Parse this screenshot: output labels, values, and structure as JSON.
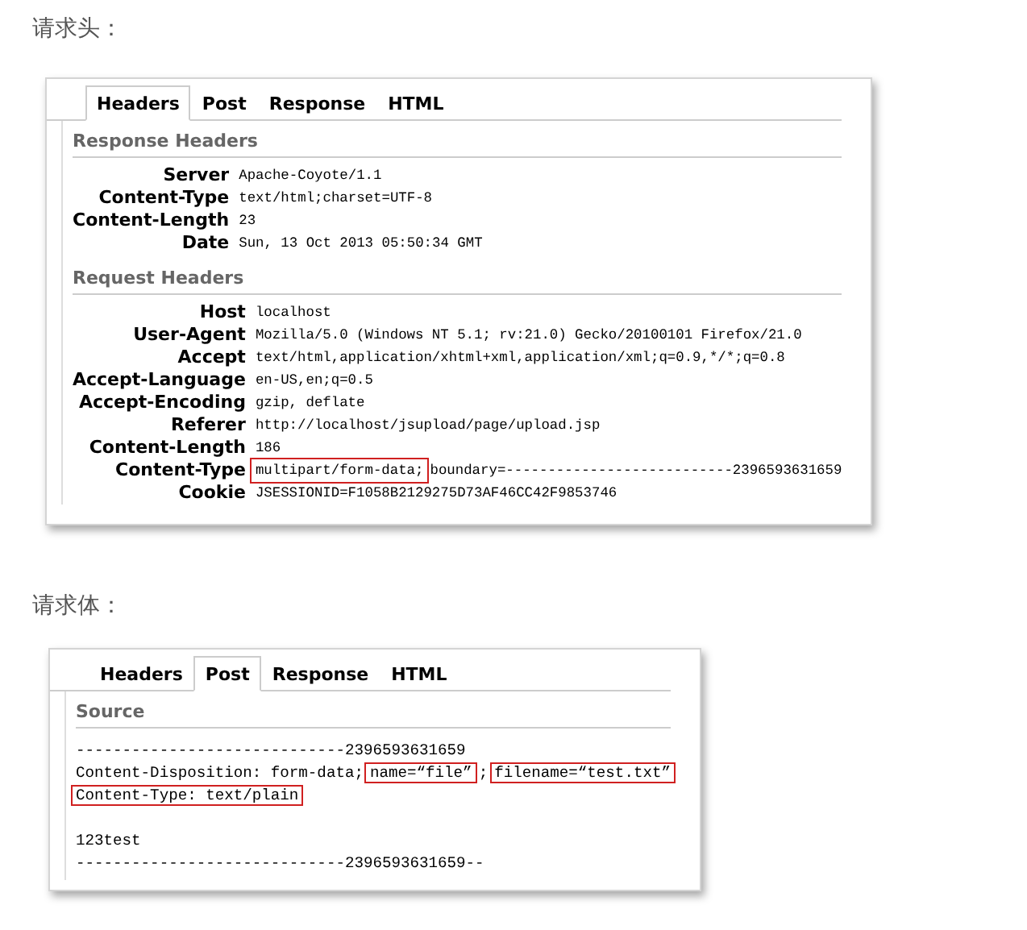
{
  "sections": [
    {
      "heading": "请求头：",
      "panel": {
        "tabs": [
          {
            "label": "Headers",
            "selected": true
          },
          {
            "label": "Post",
            "selected": false
          },
          {
            "label": "Response",
            "selected": false
          },
          {
            "label": "HTML",
            "selected": false
          }
        ],
        "groups": [
          {
            "kind": "headers",
            "title": "Response Headers",
            "rows": [
              {
                "name": "Server",
                "value": [
                  {
                    "text": "Apache-Coyote/1.1",
                    "highlight": false
                  }
                ]
              },
              {
                "name": "Content-Type",
                "value": [
                  {
                    "text": "text/html;charset=UTF-8",
                    "highlight": false
                  }
                ]
              },
              {
                "name": "Content-Length",
                "value": [
                  {
                    "text": "23",
                    "highlight": false
                  }
                ]
              },
              {
                "name": "Date",
                "value": [
                  {
                    "text": "Sun, 13 Oct 2013 05:50:34 GMT",
                    "highlight": false
                  }
                ]
              }
            ]
          },
          {
            "kind": "headers",
            "title": "Request Headers",
            "rows": [
              {
                "name": "Host",
                "value": [
                  {
                    "text": "localhost",
                    "highlight": false
                  }
                ]
              },
              {
                "name": "User-Agent",
                "value": [
                  {
                    "text": "Mozilla/5.0 (Windows NT 5.1; rv:21.0) Gecko/20100101 Firefox/21.0",
                    "highlight": false
                  }
                ]
              },
              {
                "name": "Accept",
                "value": [
                  {
                    "text": "text/html,application/xhtml+xml,application/xml;q=0.9,*/*;q=0.8",
                    "highlight": false
                  }
                ]
              },
              {
                "name": "Accept-Language",
                "value": [
                  {
                    "text": "en-US,en;q=0.5",
                    "highlight": false
                  }
                ]
              },
              {
                "name": "Accept-Encoding",
                "value": [
                  {
                    "text": "gzip, deflate",
                    "highlight": false
                  }
                ]
              },
              {
                "name": "Referer",
                "value": [
                  {
                    "text": "http://localhost/jsupload/page/upload.jsp",
                    "highlight": false
                  }
                ]
              },
              {
                "name": "Content-Length",
                "value": [
                  {
                    "text": "186",
                    "highlight": false
                  }
                ]
              },
              {
                "name": "Content-Type",
                "value": [
                  {
                    "text": "multipart/form-data;",
                    "highlight": true
                  },
                  {
                    "text": "boundary=---------------------------2396593631659",
                    "highlight": false
                  }
                ]
              },
              {
                "name": "Cookie",
                "value": [
                  {
                    "text": "JSESSIONID=F1058B2129275D73AF46CC42F9853746",
                    "highlight": false
                  }
                ]
              }
            ]
          }
        ]
      }
    },
    {
      "heading": "请求体：",
      "panel": {
        "tabs": [
          {
            "label": "Headers",
            "selected": false
          },
          {
            "label": "Post",
            "selected": true
          },
          {
            "label": "Response",
            "selected": false
          },
          {
            "label": "HTML",
            "selected": false
          }
        ],
        "groups": [
          {
            "kind": "source",
            "title": "Source",
            "lines": [
              {
                "kind": "text",
                "segments": [
                  {
                    "text": "-----------------------------2396593631659",
                    "highlight": false
                  }
                ]
              },
              {
                "kind": "text",
                "segments": [
                  {
                    "text": "Content-Disposition: form-data;",
                    "highlight": false
                  },
                  {
                    "text": "name=“file”",
                    "highlight": true
                  },
                  {
                    "text": ";",
                    "highlight": false
                  },
                  {
                    "text": "filename=“test.txt”",
                    "highlight": true
                  }
                ]
              },
              {
                "kind": "text",
                "segments": [
                  {
                    "text": "Content-Type: text/plain",
                    "highlight": true
                  }
                ]
              },
              {
                "kind": "blank"
              },
              {
                "kind": "text",
                "segments": [
                  {
                    "text": "123test",
                    "highlight": false
                  }
                ]
              },
              {
                "kind": "text",
                "segments": [
                  {
                    "text": "-----------------------------2396593631659--",
                    "highlight": false
                  }
                ]
              }
            ]
          }
        ]
      }
    }
  ]
}
